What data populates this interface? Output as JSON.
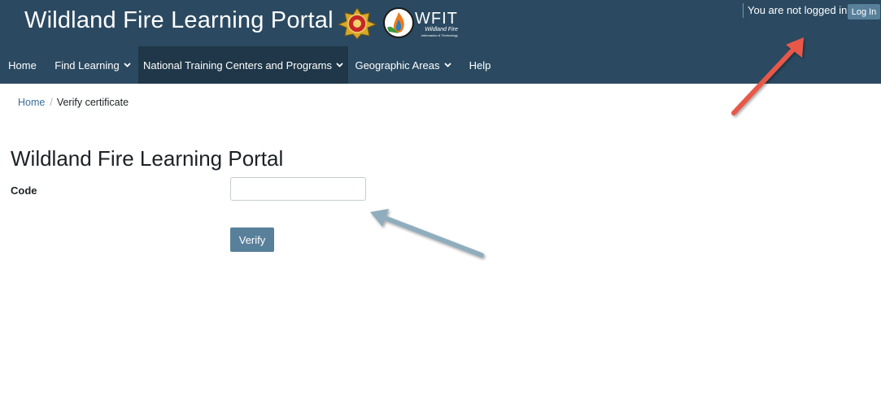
{
  "header": {
    "site_title": "Wildland Fire Learning Portal",
    "wfit_title": "WFIT",
    "wfit_subtitle_line1": "Wildland Fire",
    "wfit_subtitle_line2": "Information & Technology",
    "login_status": "You are not logged in.",
    "login_button": "Log In"
  },
  "nav": {
    "items": [
      {
        "label": "Home",
        "has_dropdown": false
      },
      {
        "label": "Find Learning",
        "has_dropdown": true
      },
      {
        "label": "National Training Centers and Programs",
        "has_dropdown": true,
        "active": true
      },
      {
        "label": "Geographic Areas",
        "has_dropdown": true
      },
      {
        "label": "Help",
        "has_dropdown": false
      }
    ],
    "dropdown_icon": "chevron-down-icon"
  },
  "breadcrumb": {
    "home": "Home",
    "current": "Verify certificate"
  },
  "main": {
    "title": "Wildland Fire Learning Portal",
    "code_label": "Code",
    "code_value": "",
    "verify_button": "Verify"
  },
  "colors": {
    "header_bg": "#2b4a61",
    "nav_active_bg": "#1f3748",
    "button_bg": "#58809b",
    "link": "#3a6e98",
    "annotation_red": "#e8584a",
    "annotation_blue": "#8fadbd"
  }
}
